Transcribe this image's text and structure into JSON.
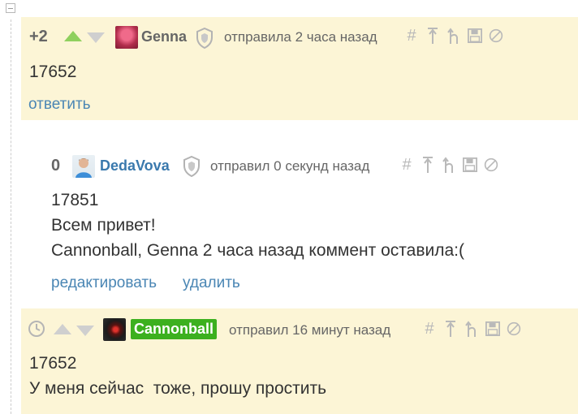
{
  "comments": [
    {
      "rating": "+2",
      "username": "Genna",
      "meta": "отправила 2 часа назад",
      "body": [
        "17652"
      ],
      "actions": [
        "ответить"
      ]
    },
    {
      "rating": "0",
      "username": "DedaVova",
      "meta": "отправил 0 секунд назад",
      "body": [
        "17851",
        "Всем привет!",
        "Cannonball, Genna 2 часа назад коммент оставила:("
      ],
      "actions": [
        "редактировать",
        "удалить"
      ]
    },
    {
      "rating": "",
      "username": "Cannonball",
      "meta": "отправил 16 минут назад",
      "body": [
        "17652",
        "У меня сейчас  тоже, прошу простить"
      ],
      "actions": []
    }
  ],
  "tools": {
    "link_icon": "#",
    "icons": [
      "hash-link-icon",
      "go-to-top-icon",
      "go-to-parent-icon",
      "save-icon",
      "block-icon"
    ]
  },
  "colors": {
    "highlight_bg": "#fcf5d6",
    "link": "#4a86b4",
    "upvote_active": "#8fd05e",
    "badge_green": "#3cb01f"
  }
}
